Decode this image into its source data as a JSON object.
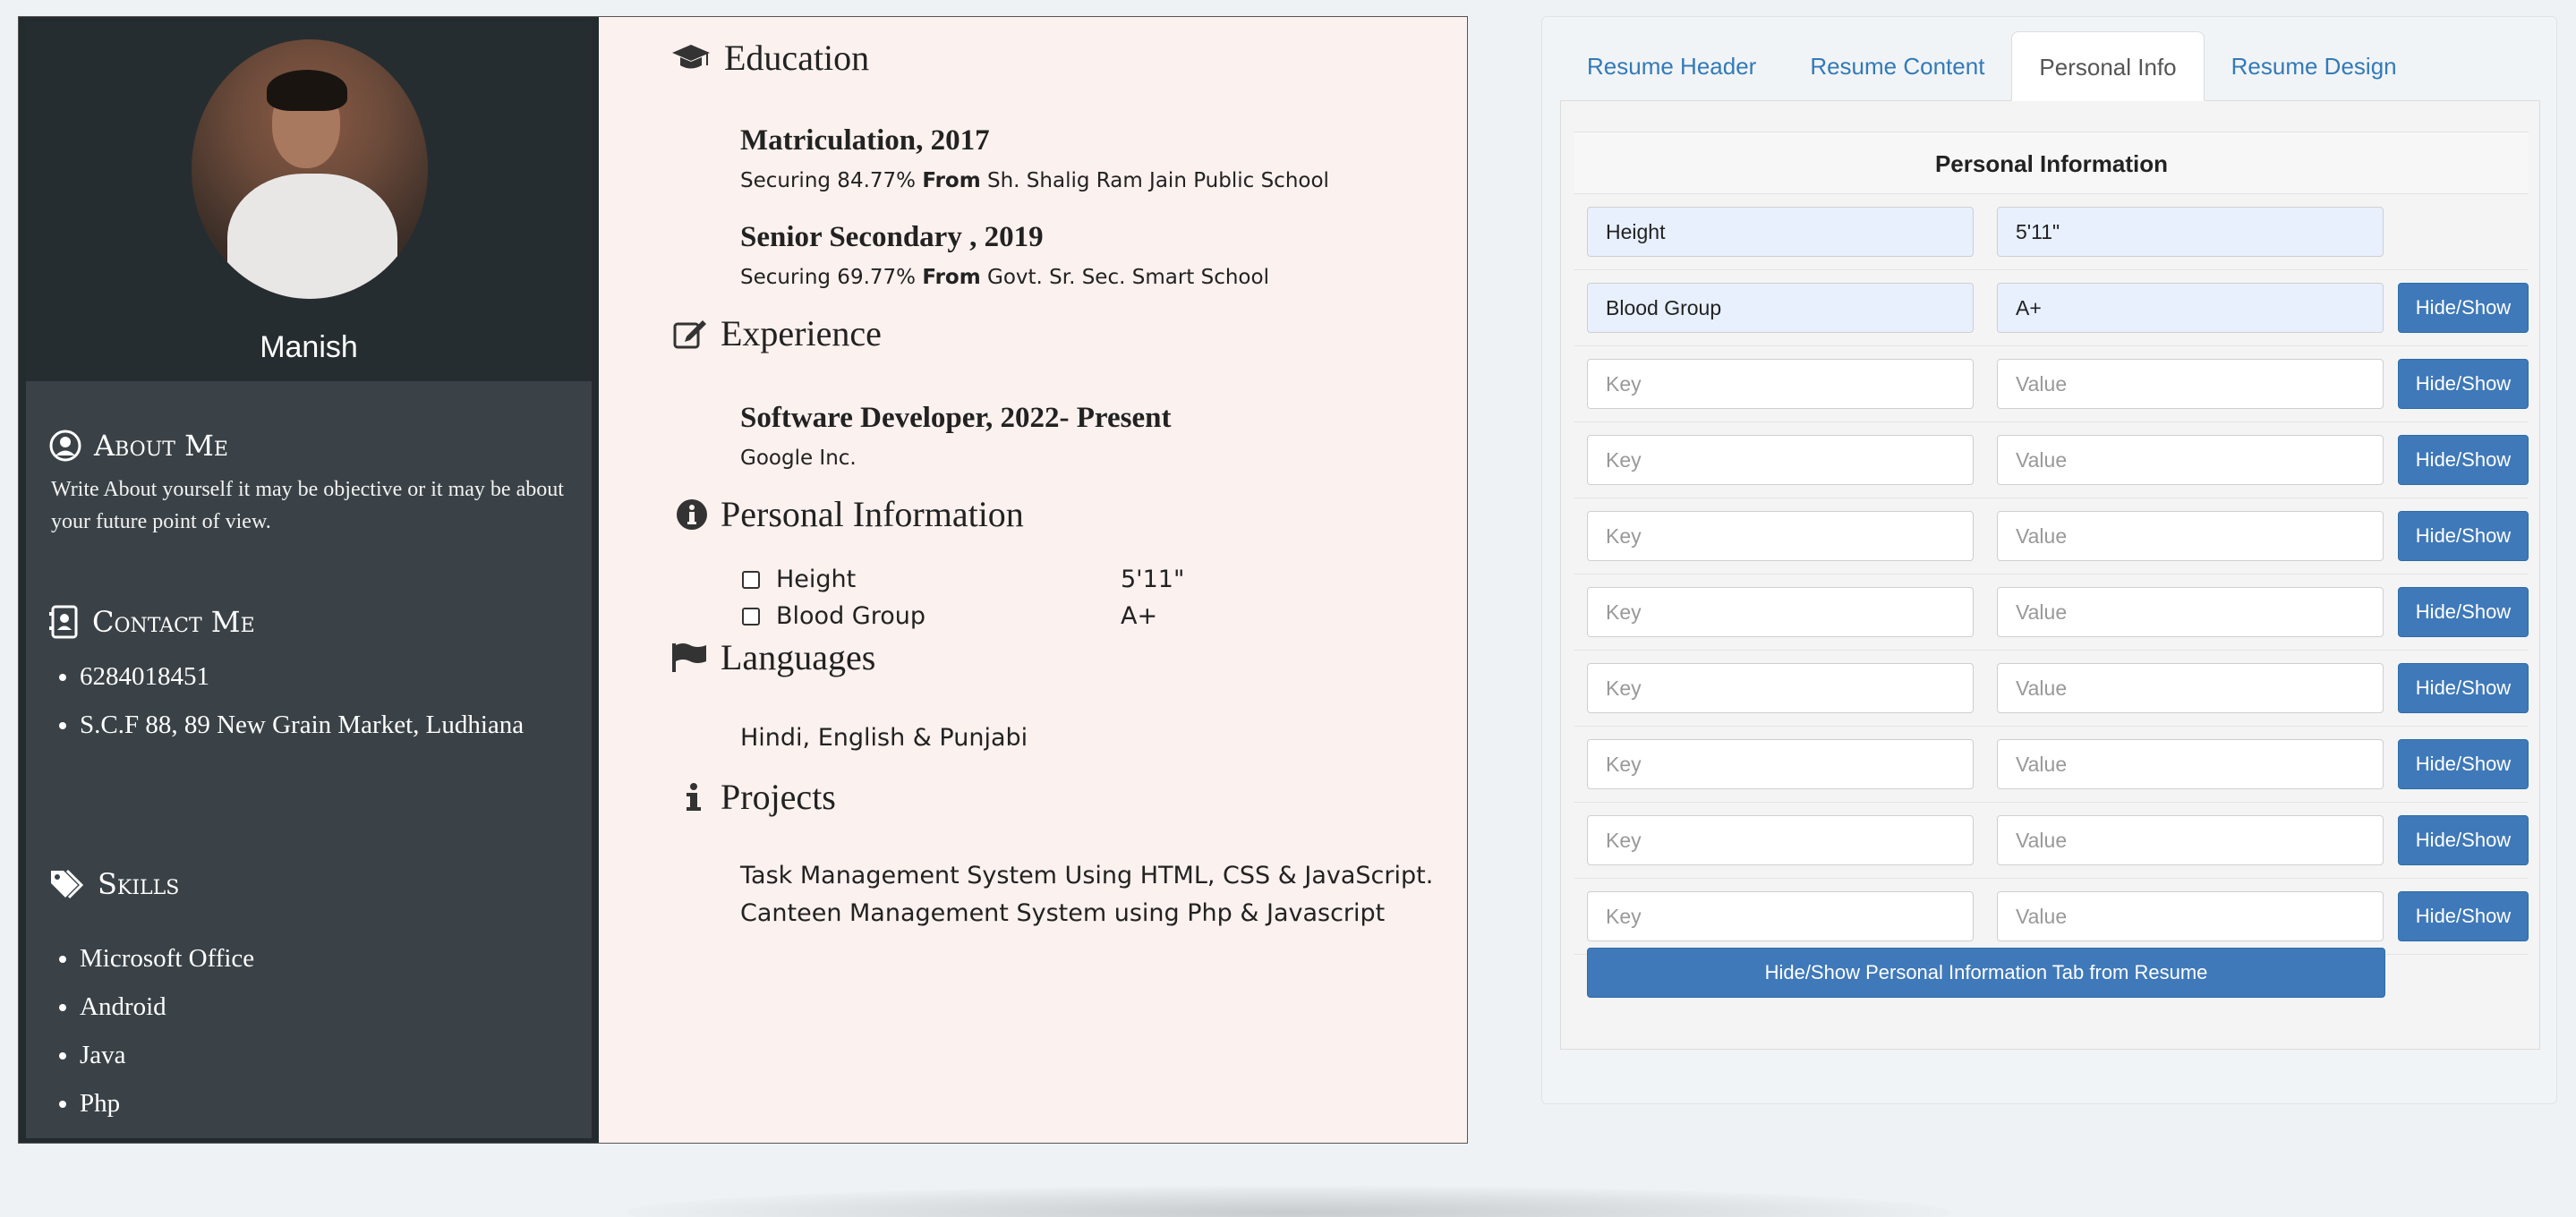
{
  "resume": {
    "name": "Manish",
    "about": {
      "heading": "About Me",
      "text": "Write About yourself it may be objective or it may be about your future point of view."
    },
    "contact": {
      "heading": "Contact Me",
      "items": [
        "6284018451",
        "S.C.F 88, 89 New Grain Market, Ludhiana"
      ]
    },
    "skills": {
      "heading": "Skills",
      "items": [
        "Microsoft Office",
        "Android",
        "Java",
        "Php"
      ]
    },
    "education": {
      "heading": "Education",
      "entries": [
        {
          "title": "Matriculation, 2017",
          "prefix": "Securing 84.77%",
          "from_label": "From",
          "school": "Sh. Shalig Ram Jain Public School"
        },
        {
          "title": "Senior Secondary , 2019",
          "prefix": "Securing 69.77%",
          "from_label": "From",
          "school": "Govt. Sr. Sec. Smart School"
        }
      ]
    },
    "experience": {
      "heading": "Experience",
      "title": "Software Developer, 2022- Present",
      "company": "Google Inc."
    },
    "personal_info": {
      "heading": "Personal Information",
      "rows": [
        {
          "key": "Height",
          "value": "5'11\""
        },
        {
          "key": "Blood Group",
          "value": "A+"
        }
      ]
    },
    "languages": {
      "heading": "Languages",
      "text": "Hindi, English & Punjabi"
    },
    "projects": {
      "heading": "Projects",
      "items": [
        "Task Management System Using HTML, CSS & JavaScript.",
        "Canteen Management System using Php & Javascript"
      ]
    }
  },
  "editor": {
    "tabs": [
      {
        "label": "Resume Header",
        "active": false
      },
      {
        "label": "Resume Content",
        "active": false
      },
      {
        "label": "Personal Info",
        "active": true
      },
      {
        "label": "Resume Design",
        "active": false
      }
    ],
    "section_title": "Personal Information",
    "key_placeholder": "Key",
    "value_placeholder": "Value",
    "hide_show_label": "Hide/Show",
    "rows": [
      {
        "key": "Height",
        "value": "5'11\"",
        "has_button": false
      },
      {
        "key": "Blood Group",
        "value": "A+",
        "has_button": true
      },
      {
        "key": "",
        "value": "",
        "has_button": true
      },
      {
        "key": "",
        "value": "",
        "has_button": true
      },
      {
        "key": "",
        "value": "",
        "has_button": true
      },
      {
        "key": "",
        "value": "",
        "has_button": true
      },
      {
        "key": "",
        "value": "",
        "has_button": true
      },
      {
        "key": "",
        "value": "",
        "has_button": true
      },
      {
        "key": "",
        "value": "",
        "has_button": true
      },
      {
        "key": "",
        "value": "",
        "has_button": true
      }
    ],
    "toggle_tab_label": "Hide/Show Personal Information Tab from Resume"
  },
  "colors": {
    "sidebar_dark": "#262d30",
    "sidebar": "#3a4247",
    "resume_bg": "#fbf1ee",
    "link_blue": "#337ab7",
    "button_blue": "#3f79b9",
    "autofill_bg": "#e8f0fe"
  }
}
